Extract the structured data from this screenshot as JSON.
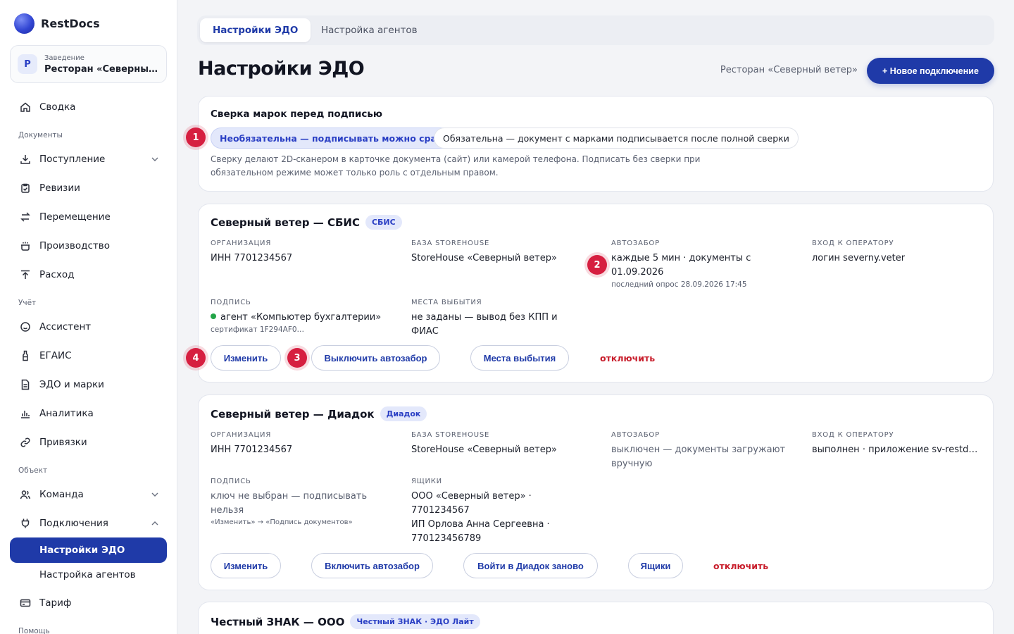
{
  "brand": {
    "name": "RestDocs"
  },
  "venue": {
    "label": "Заведение",
    "avatar": "Р",
    "name": "Ресторан «Северный ветер»"
  },
  "nav": {
    "summary": "Сводка",
    "section_docs": "Документы",
    "incoming": "Поступление",
    "revisions": "Ревизии",
    "transfer": "Перемещение",
    "production": "Производство",
    "expense": "Расход",
    "section_accounting": "Учёт",
    "assistant": "Ассистент",
    "egais": "ЕГАИС",
    "edo_marks": "ЭДО и марки",
    "analytics": "Аналитика",
    "bindings": "Привязки",
    "section_object": "Объект",
    "team": "Команда",
    "connections": "Подключения",
    "edo_settings": "Настройки ЭДО",
    "agent_settings": "Настройка агентов",
    "tariff": "Тариф",
    "section_help": "Помощь"
  },
  "tabs": {
    "edo": "Настройки ЭДО",
    "agents": "Настройка агентов"
  },
  "header": {
    "title": "Настройки ЭДО",
    "context": "Ресторан «Северный ветер»",
    "new_connection": "+ Новое подключение"
  },
  "verify": {
    "title": "Сверка марок перед подписью",
    "option_optional": "Необязательна — подписывать можно сразу",
    "option_required": "Обязательна — документ с марками подписывается после полной сверки",
    "help": "Сверку делают 2D-сканером в карточке документа (сайт) или камерой телефона. Подписать без сверки при обязательном режиме может только роль с отдельным правом."
  },
  "sbis": {
    "title": "Северный ветер — СБИС",
    "tag": "СБИС",
    "org_label": "Организация",
    "org_value": "ИНН 7701234567",
    "base_label": "База StoreHouse",
    "base_value": "StoreHouse «Северный ветер»",
    "auto_label": "Автозабор",
    "auto_value": "каждые 5 мин · документы с 01.09.2026",
    "auto_note": "последний опрос 28.09.2026 17:45",
    "login_label": "Вход к оператору",
    "login_value": "логин severny.veter",
    "sign_label": "Подпись",
    "sign_value": "агент «Компьютер бухгалтерии»",
    "sign_note": "сертификат 1F294AF0…",
    "places_label": "Места выбытия",
    "places_value": "не заданы — вывод без КПП и ФИАС",
    "btn_edit": "Изменить",
    "btn_auto": "Выключить автозабор",
    "btn_places": "Места выбытия",
    "btn_disconnect": "отключить"
  },
  "diadoc": {
    "title": "Северный ветер — Диадок",
    "tag": "Диадок",
    "org_label": "Организация",
    "org_value": "ИНН 7701234567",
    "base_label": "База StoreHouse",
    "base_value": "StoreHouse «Северный ветер»",
    "auto_label": "Автозабор",
    "auto_value": "выключен — документы загружают вручную",
    "login_label": "Вход к оператору",
    "login_value": "выполнен · приложение sv-restdocs",
    "sign_label": "Подпись",
    "sign_value": "ключ не выбран — подписывать нельзя",
    "sign_note": "«Изменить» → «Подпись документов»",
    "boxes_label": "Ящики",
    "box1": "ООО «Северный ветер» · 7701234567",
    "box2": "ИП Орлова Анна Сергеевна · 770123456789",
    "btn_edit": "Изменить",
    "btn_auto": "Включить автозабор",
    "btn_relogin": "Войти в Диадок заново",
    "btn_boxes": "Ящики",
    "btn_disconnect": "отключить"
  },
  "honest": {
    "title": "Честный ЗНАК — ООО",
    "tag": "Честный ЗНАК · ЭДО Лайт"
  },
  "badges": {
    "b1": "1",
    "b2": "2",
    "b3": "3",
    "b4": "4"
  }
}
